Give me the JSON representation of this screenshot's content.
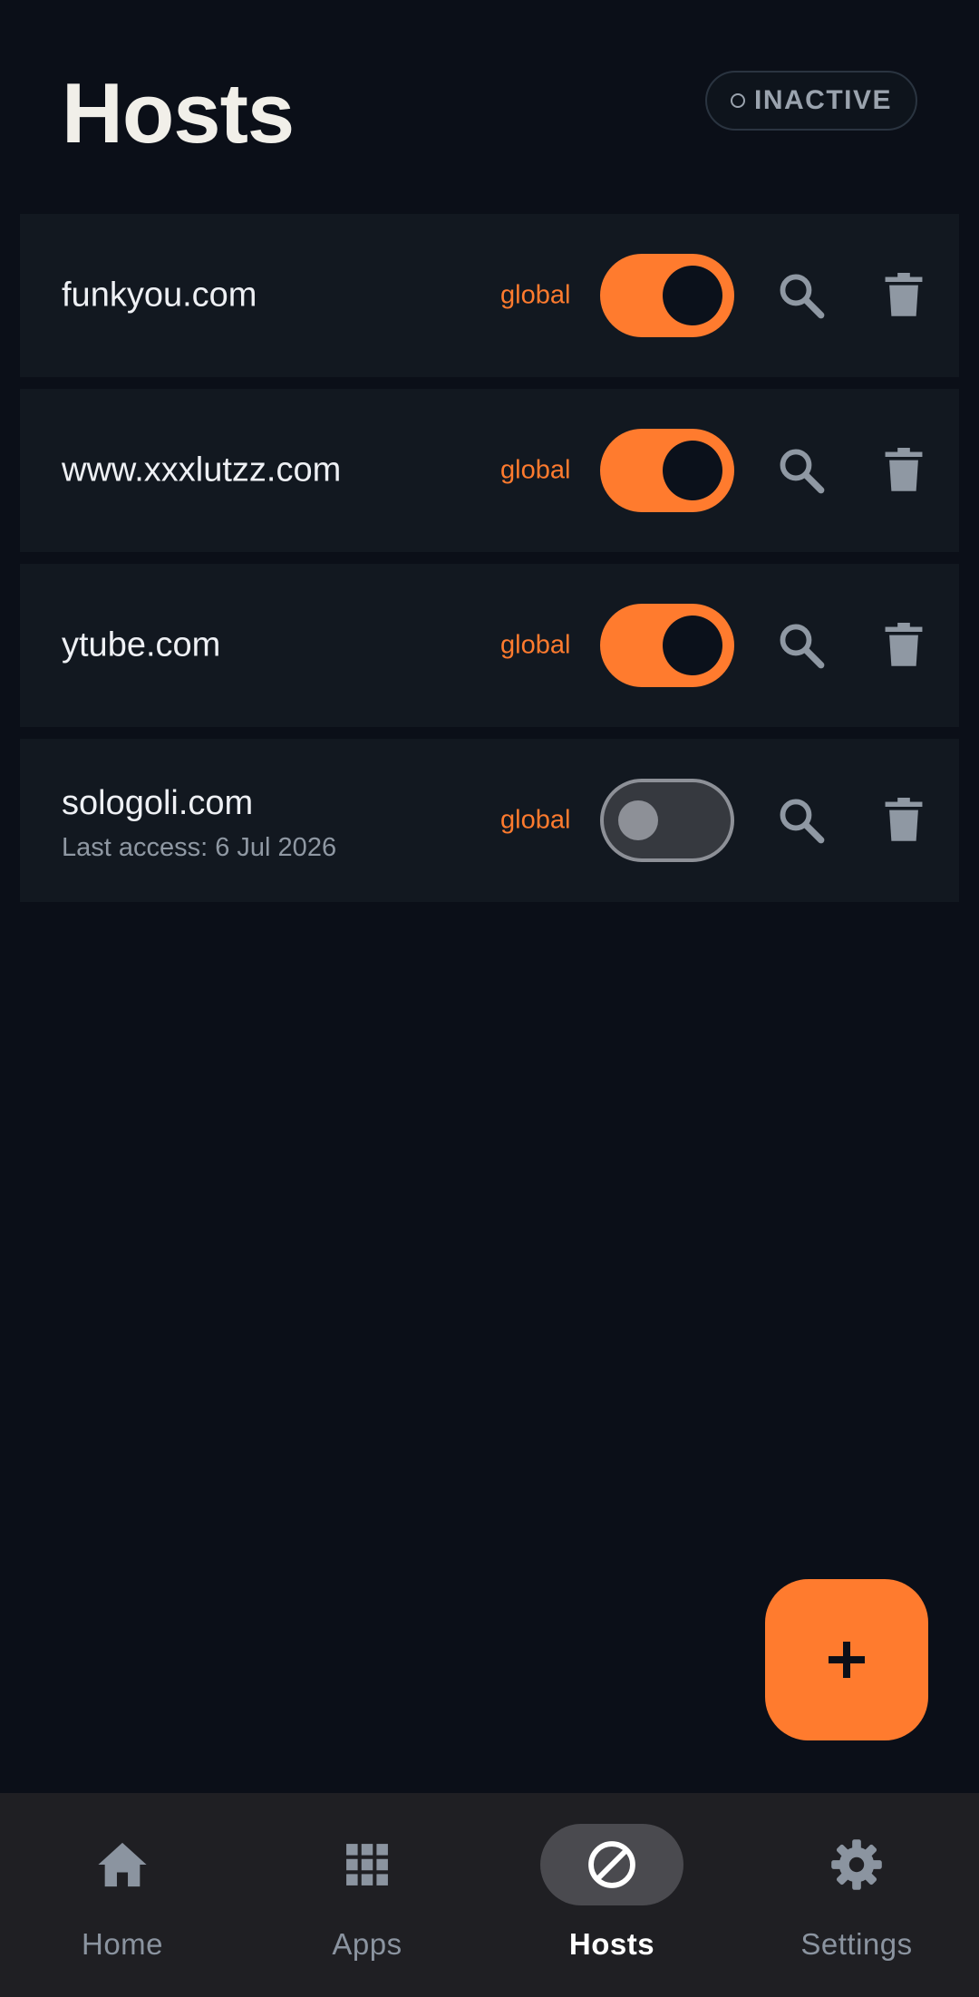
{
  "header": {
    "title": "Hosts",
    "status": "INACTIVE"
  },
  "hosts": [
    {
      "name": "funkyou.com",
      "sub": "",
      "scope": "global",
      "enabled": true
    },
    {
      "name": "www.xxxlutzz.com",
      "sub": "",
      "scope": "global",
      "enabled": true
    },
    {
      "name": "ytube.com",
      "sub": "",
      "scope": "global",
      "enabled": true
    },
    {
      "name": "sologoli.com",
      "sub": "Last access: 6 Jul 2026",
      "scope": "global",
      "enabled": false
    }
  ],
  "icons": {
    "row_search": "search-icon",
    "row_delete": "trash-icon",
    "fab": "plus-icon",
    "status": "circle-outline-icon"
  },
  "nav": {
    "items": [
      {
        "label": "Home",
        "icon": "home-icon",
        "active": false
      },
      {
        "label": "Apps",
        "icon": "apps-grid-icon",
        "active": false
      },
      {
        "label": "Hosts",
        "icon": "block-icon",
        "active": true
      },
      {
        "label": "Settings",
        "icon": "gear-icon",
        "active": false
      }
    ]
  },
  "colors": {
    "background": "#0b0f18",
    "row_background": "#121820",
    "accent": "#ff7b2e",
    "muted_text": "#8f98a3",
    "nav_background": "#1f1f23",
    "nav_active_pill": "#4a4a4f"
  }
}
